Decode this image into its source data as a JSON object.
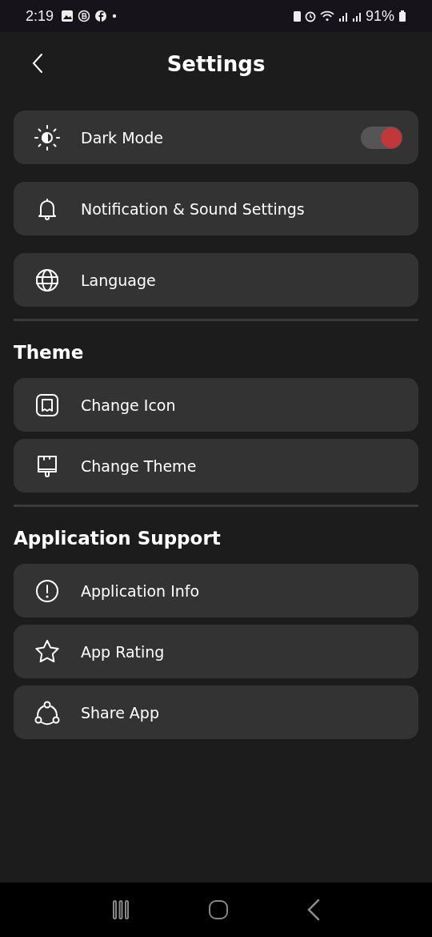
{
  "status_bar": {
    "time": "2:19",
    "battery": "91%"
  },
  "header": {
    "title": "Settings"
  },
  "sections": [
    {
      "items": [
        {
          "kind": "toggle",
          "label": "Dark Mode",
          "on": true
        },
        {
          "kind": "link",
          "label": "Notification & Sound Settings"
        },
        {
          "kind": "link",
          "label": "Language"
        }
      ]
    },
    {
      "heading": "Theme",
      "items": [
        {
          "kind": "link",
          "label": "Change Icon"
        },
        {
          "kind": "link",
          "label": "Change Theme"
        }
      ]
    },
    {
      "heading": "Application Support",
      "items": [
        {
          "kind": "link",
          "label": "Application Info"
        },
        {
          "kind": "link",
          "label": "App Rating"
        },
        {
          "kind": "link",
          "label": "Share App"
        }
      ]
    }
  ]
}
